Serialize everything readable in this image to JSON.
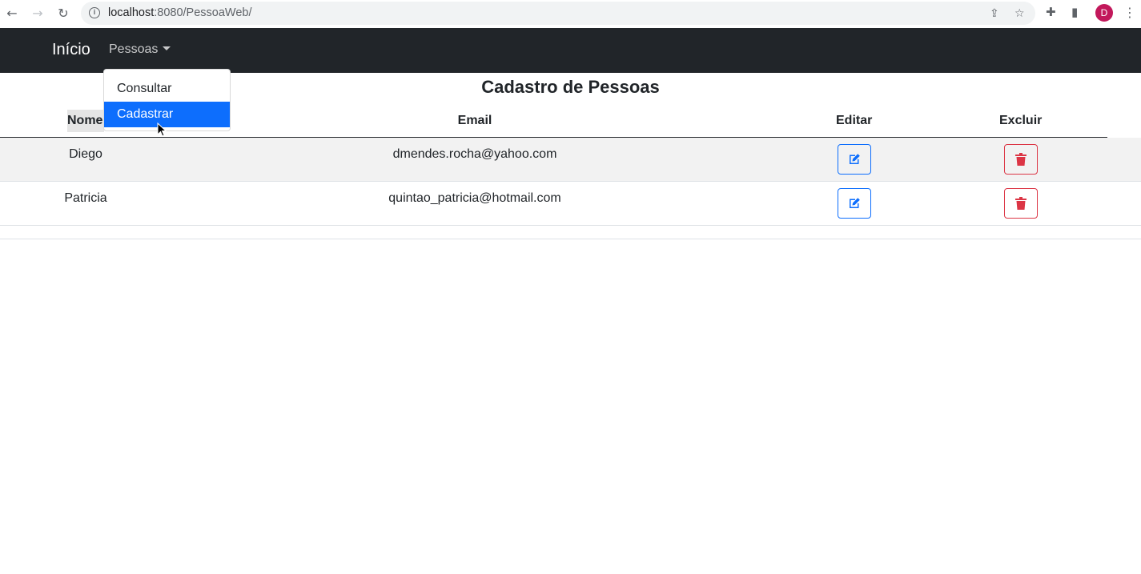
{
  "browser": {
    "url_host": "localhost",
    "url_rest": ":8080/PessoaWeb/",
    "avatar_letter": "D",
    "avatar_color": "#c2185b"
  },
  "navbar": {
    "brand": "Início",
    "dropdown_label": "Pessoas",
    "menu_items": [
      "Consultar",
      "Cadastrar"
    ],
    "active_item": "Cadastrar"
  },
  "page": {
    "title": "Cadastro de Pessoas"
  },
  "table": {
    "headers": {
      "name": "Nome",
      "email": "Email",
      "edit": "Editar",
      "delete": "Excluir"
    },
    "rows": [
      {
        "name": "Diego",
        "email": "dmendes.rocha@yahoo.com"
      },
      {
        "name": "Patricia",
        "email": "quintao_patricia@hotmail.com"
      }
    ]
  },
  "colors": {
    "navbar_bg": "#212529",
    "primary": "#0d6efd",
    "danger": "#dc3545"
  }
}
